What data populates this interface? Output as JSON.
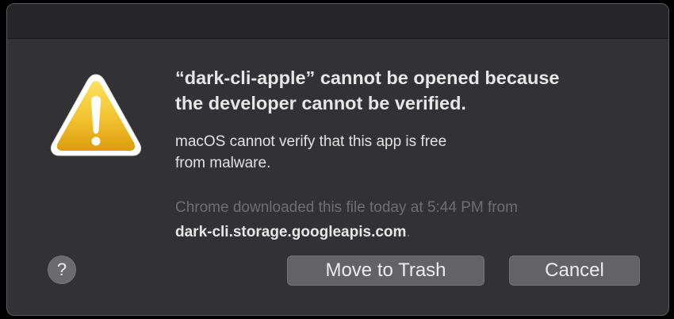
{
  "dialog": {
    "heading_line1": "“dark-cli-apple” cannot be opened because",
    "heading_line2": "the developer cannot be verified.",
    "message_line1": "macOS cannot verify that this app is free",
    "message_line2": "from malware.",
    "info_text": "Chrome downloaded this file today at 5:44 PM from",
    "info_host": "dark-cli.storage.googleapis.com",
    "info_suffix": ".",
    "icon": "warning-triangle-icon"
  },
  "buttons": {
    "help_label": "?",
    "trash_label": "Move to Trash",
    "cancel_label": "Cancel"
  },
  "colors": {
    "dialog_background": "#323234",
    "titlebar_background": "#262628",
    "button_background": "#636366",
    "warning_yellow": "#f2c12e",
    "secondary_text": "#6f6f72"
  }
}
